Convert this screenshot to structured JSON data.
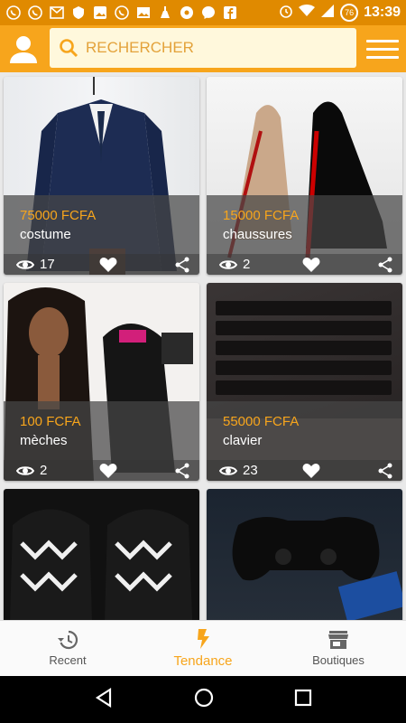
{
  "status_bar": {
    "time": "13:39",
    "battery": "76",
    "icons": [
      "whatsapp-icon",
      "whatsapp-icon",
      "gmail-icon",
      "shield-app-icon",
      "image-app-icon",
      "whatsapp-icon",
      "gallery-icon",
      "cleaner-icon",
      "soccer-icon",
      "messenger-icon",
      "facebook-icon",
      "alarm-icon",
      "wifi-icon",
      "signal-icon",
      "battery-icon"
    ]
  },
  "header": {
    "search_placeholder": "RECHERCHER"
  },
  "colors": {
    "accent": "#f7a51c",
    "status_bar": "#e08a00",
    "price": "#f7a51c"
  },
  "products": [
    {
      "price": "75000 FCFA",
      "name": "costume",
      "views": "17"
    },
    {
      "price": "15000 FCFA",
      "name": "chaussures",
      "views": "2"
    },
    {
      "price": "100 FCFA",
      "name": "mèches",
      "views": "2"
    },
    {
      "price": "55000 FCFA",
      "name": "clavier",
      "views": "23"
    },
    {
      "price": "",
      "name": "",
      "views": ""
    },
    {
      "price": "",
      "name": "",
      "views": ""
    }
  ],
  "bottom_nav": {
    "items": [
      {
        "label": "Recent",
        "icon": "history-icon"
      },
      {
        "label": "Tendance",
        "icon": "flash-icon"
      },
      {
        "label": "Boutiques",
        "icon": "store-icon"
      }
    ],
    "active": "Tendance"
  }
}
